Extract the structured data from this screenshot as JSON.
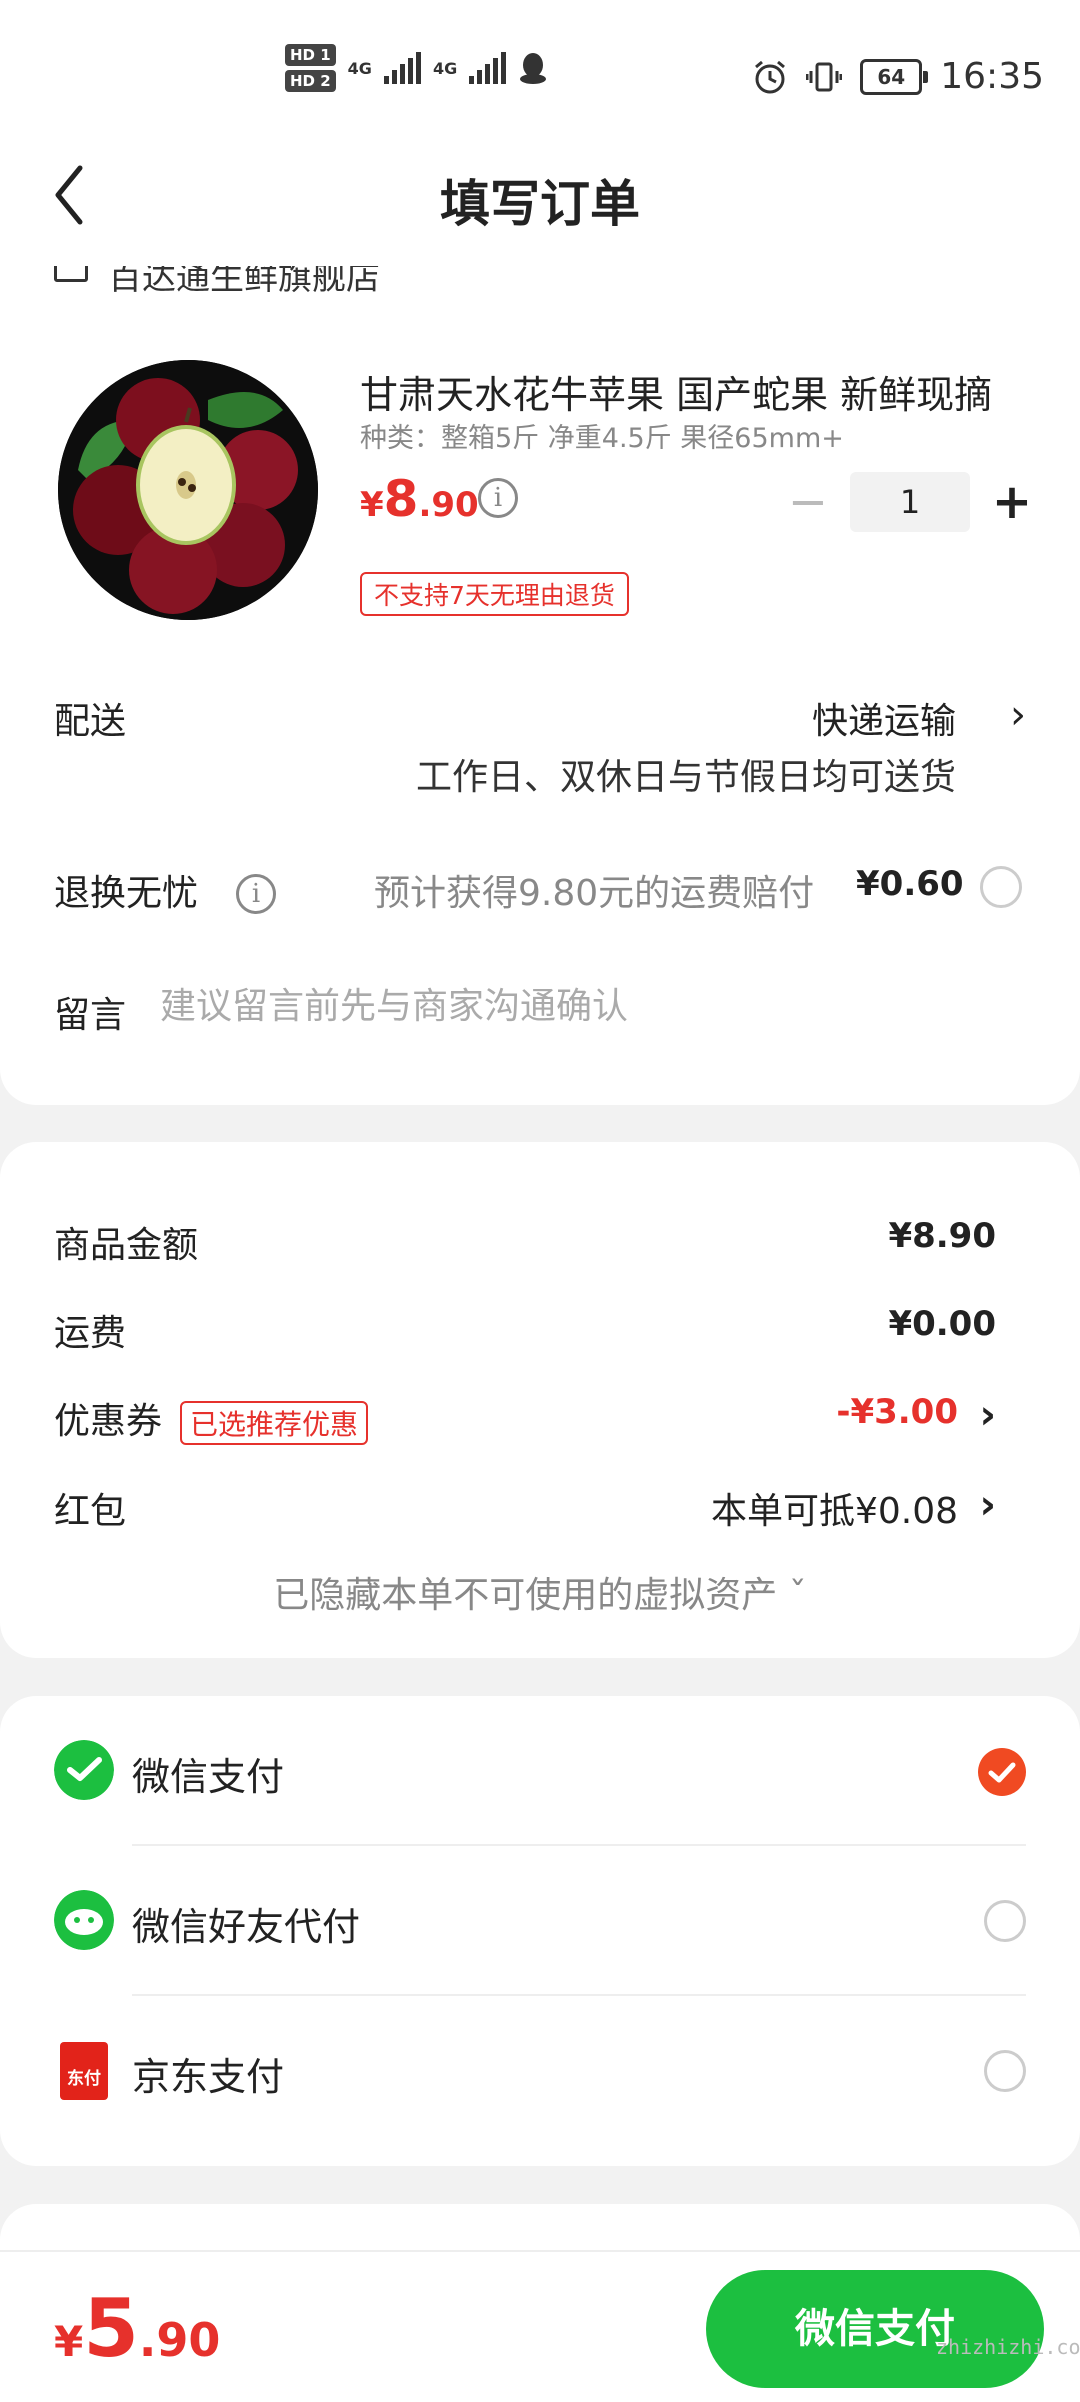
{
  "status_bar": {
    "hd1": "HD 1",
    "hd2": "HD 2",
    "net1": "4G",
    "net2": "4G",
    "battery": "64",
    "time": "16:35"
  },
  "header": {
    "title": "填写订单",
    "back_icon": "chevron-left-icon"
  },
  "shop": {
    "name": "百达通生鲜旗舰店"
  },
  "product": {
    "name": "甘肃天水花牛苹果 国产蛇果 新鲜现摘",
    "spec": "种类：整箱5斤 净重4.5斤 果径65mm+",
    "price_currency": "¥",
    "price_int": "8",
    "price_dec": ".90",
    "quantity": "1",
    "minus": "−",
    "plus": "+",
    "badge": "不支持7天无理由退货"
  },
  "delivery": {
    "label": "配送",
    "value": "快递运输",
    "sub": "工作日、双休日与节假日均可送货"
  },
  "return_worry_free": {
    "label": "退换无忧",
    "desc": "预计获得9.80元的运费赔付",
    "price": "¥0.60"
  },
  "message": {
    "label": "留言",
    "placeholder": "建议留言前先与商家沟通确认"
  },
  "summary": {
    "goods_label": "商品金额",
    "goods_value": "¥8.90",
    "shipping_label": "运费",
    "shipping_value": "¥0.00",
    "coupon_label": "优惠券",
    "coupon_tag": "已选推荐优惠",
    "coupon_value": "-¥3.00",
    "redpacket_label": "红包",
    "redpacket_value": "本单可抵¥0.08",
    "hidden_assets": "已隐藏本单不可使用的虚拟资产 ˇ"
  },
  "payment_methods": [
    {
      "name": "微信支付",
      "icon": "wechat-pay-icon",
      "selected": true
    },
    {
      "name": "微信好友代付",
      "icon": "wechat-friend-pay-icon",
      "selected": false
    },
    {
      "name": "京东支付",
      "icon": "jd-pay-icon",
      "selected": false
    }
  ],
  "jd_icon_text": "东付",
  "footer": {
    "total_currency": "¥",
    "total_int": "5",
    "total_dec": ".90",
    "pay_button": "微信支付",
    "watermark": "zhizhizhi.com"
  },
  "colors": {
    "accent_red": "#e6312c",
    "wechat_green": "#1cbf40",
    "checked_orange": "#f04a22"
  }
}
